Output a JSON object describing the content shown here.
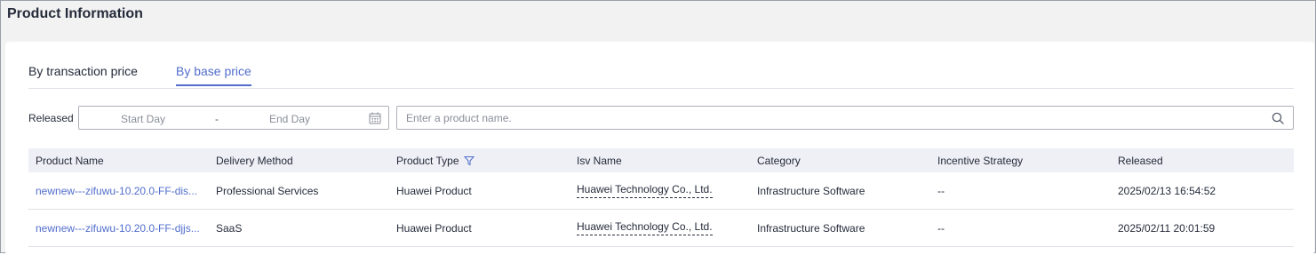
{
  "page": {
    "title": "Product Information"
  },
  "tabs": [
    {
      "label": "By transaction price",
      "active": false
    },
    {
      "label": "By base price",
      "active": true
    }
  ],
  "filters": {
    "released_label": "Released",
    "start_placeholder": "Start Day",
    "separator": "-",
    "end_placeholder": "End Day",
    "search_placeholder": "Enter a product name.",
    "search_value": ""
  },
  "table": {
    "columns": [
      "Product Name",
      "Delivery Method",
      "Product Type",
      "Isv Name",
      "Category",
      "Incentive Strategy",
      "Released"
    ],
    "rows": [
      [
        "newnew---zifuwu-10.20.0-FF-dis...",
        "Professional Services",
        "Huawei Product",
        "Huawei Technology Co., Ltd.",
        "Infrastructure Software",
        "--",
        "2025/02/13 16:54:52"
      ],
      [
        "newnew---zifuwu-10.20.0-FF-djjs...",
        "SaaS",
        "Huawei Product",
        "Huawei Technology Co., Ltd.",
        "Infrastructure Software",
        "--",
        "2025/02/11 20:01:59"
      ]
    ]
  },
  "icons": {
    "calendar": "calendar-icon",
    "search": "search-icon",
    "filter": "filter-icon"
  },
  "colors": {
    "accent": "#526ecc",
    "text": "#252b3a",
    "header_bg": "#eef0f5",
    "placeholder": "#8a8e99"
  }
}
